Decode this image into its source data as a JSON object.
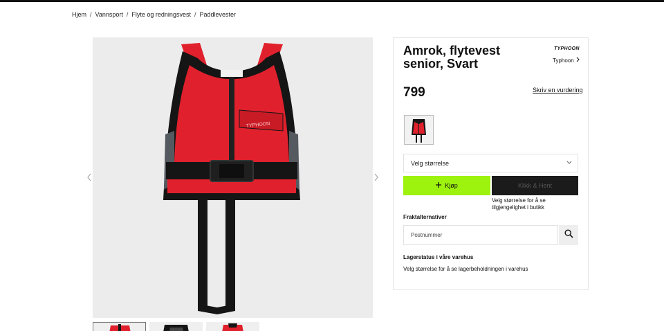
{
  "breadcrumb": {
    "items": [
      "Hjem",
      "Vannsport",
      "Flyte og redningsvest",
      "Paddlevester"
    ],
    "separator": "/"
  },
  "gallery": {
    "prev_icon": "chevron-left-icon",
    "next_icon": "chevron-right-icon",
    "thumbnail_count": 3
  },
  "product": {
    "title": "Amrok, flytevest senior, Svart",
    "brand_logo_text": "TYPHOON",
    "brand_link": "Typhoon",
    "price": "799",
    "review_link": "Skriv en vurdering"
  },
  "size": {
    "placeholder": "Velg størrelse"
  },
  "actions": {
    "buy_label": "Kjøp",
    "click_collect_label": "Klikk & Hent",
    "click_collect_note": "Velg størrelse for å se tilgjengelighet i butikk"
  },
  "shipping": {
    "label": "Fraktalternativer",
    "postal_placeholder": "Postnummer"
  },
  "stock": {
    "label": "Lagerstatus i våre varehus",
    "text": "Velg størrelse for å se lagerbeholdningen i varehus"
  },
  "colors": {
    "accent_green": "#9df20e",
    "dark_button": "#1b1b1b",
    "vest_red": "#e0212d",
    "vest_black": "#151515"
  }
}
